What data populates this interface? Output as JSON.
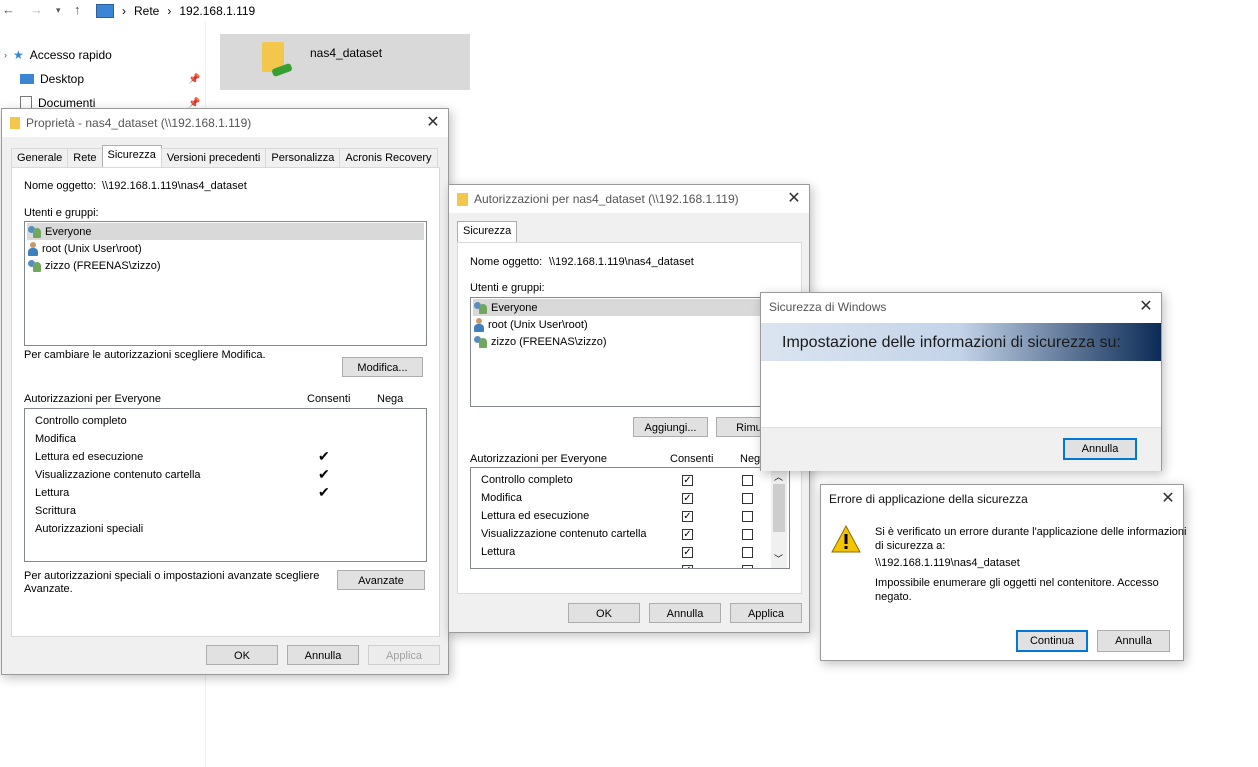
{
  "explorer": {
    "breadcrumb": [
      "Rete",
      "192.168.1.119"
    ],
    "sidebar": [
      {
        "label": "Accesso rapido"
      },
      {
        "label": "Desktop"
      },
      {
        "label": "Documenti"
      }
    ],
    "folder_name": "nas4_dataset"
  },
  "props": {
    "title": "Proprietà - nas4_dataset (\\\\192.168.1.119)",
    "tabs": [
      "Generale",
      "Rete",
      "Sicurezza",
      "Versioni precedenti",
      "Personalizza",
      "Acronis Recovery"
    ],
    "object_label": "Nome oggetto:",
    "object_value": "\\\\192.168.1.119\\nas4_dataset",
    "groups_label": "Utenti e gruppi:",
    "users": [
      "Everyone",
      "root (Unix User\\root)",
      "zizzo (FREENAS\\zizzo)"
    ],
    "change_hint": "Per cambiare le autorizzazioni scegliere Modifica.",
    "modify_btn": "Modifica...",
    "perm_label": "Autorizzazioni per Everyone",
    "allow_label": "Consenti",
    "deny_label": "Nega",
    "perms": [
      "Controllo completo",
      "Modifica",
      "Lettura ed esecuzione",
      "Visualizzazione contenuto cartella",
      "Lettura",
      "Scrittura",
      "Autorizzazioni speciali"
    ],
    "advanced_hint_1": "Per autorizzazioni speciali o impostazioni avanzate scegliere",
    "advanced_hint_2": "Avanzate.",
    "advanced_btn": "Avanzate",
    "ok": "OK",
    "cancel": "Annulla",
    "apply": "Applica"
  },
  "auth": {
    "title": "Autorizzazioni per nas4_dataset (\\\\192.168.1.119)",
    "tab": "Sicurezza",
    "object_label": "Nome oggetto:",
    "object_value": "\\\\192.168.1.119\\nas4_dataset",
    "groups_label": "Utenti e gruppi:",
    "users": [
      "Everyone",
      "root (Unix User\\root)",
      "zizzo (FREENAS\\zizzo)"
    ],
    "add_btn": "Aggiungi...",
    "remove_btn": "Rimuo",
    "perm_label": "Autorizzazioni per Everyone",
    "allow_label": "Consenti",
    "deny_label": "Nega",
    "perms": [
      "Controllo completo",
      "Modifica",
      "Lettura ed esecuzione",
      "Visualizzazione contenuto cartella",
      "Lettura"
    ],
    "ok": "OK",
    "cancel": "Annulla",
    "apply": "Applica"
  },
  "winsec": {
    "title": "Sicurezza di Windows",
    "banner": "Impostazione delle informazioni di sicurezza su:",
    "cancel": "Annulla"
  },
  "error": {
    "title": "Errore di applicazione della sicurezza",
    "line1": "Si è verificato un errore durante l'applicazione delle informazioni",
    "line2": "di sicurezza a:",
    "path": "\\\\192.168.1.119\\nas4_dataset",
    "msg1": "Impossibile enumerare gli oggetti nel contenitore. Accesso",
    "msg2": "negato.",
    "continue": "Continua",
    "cancel": "Annulla"
  },
  "colors": {
    "accent": "#0078d7",
    "banner_start": "#dbe5f1",
    "banner_end": "#0b2a55"
  }
}
